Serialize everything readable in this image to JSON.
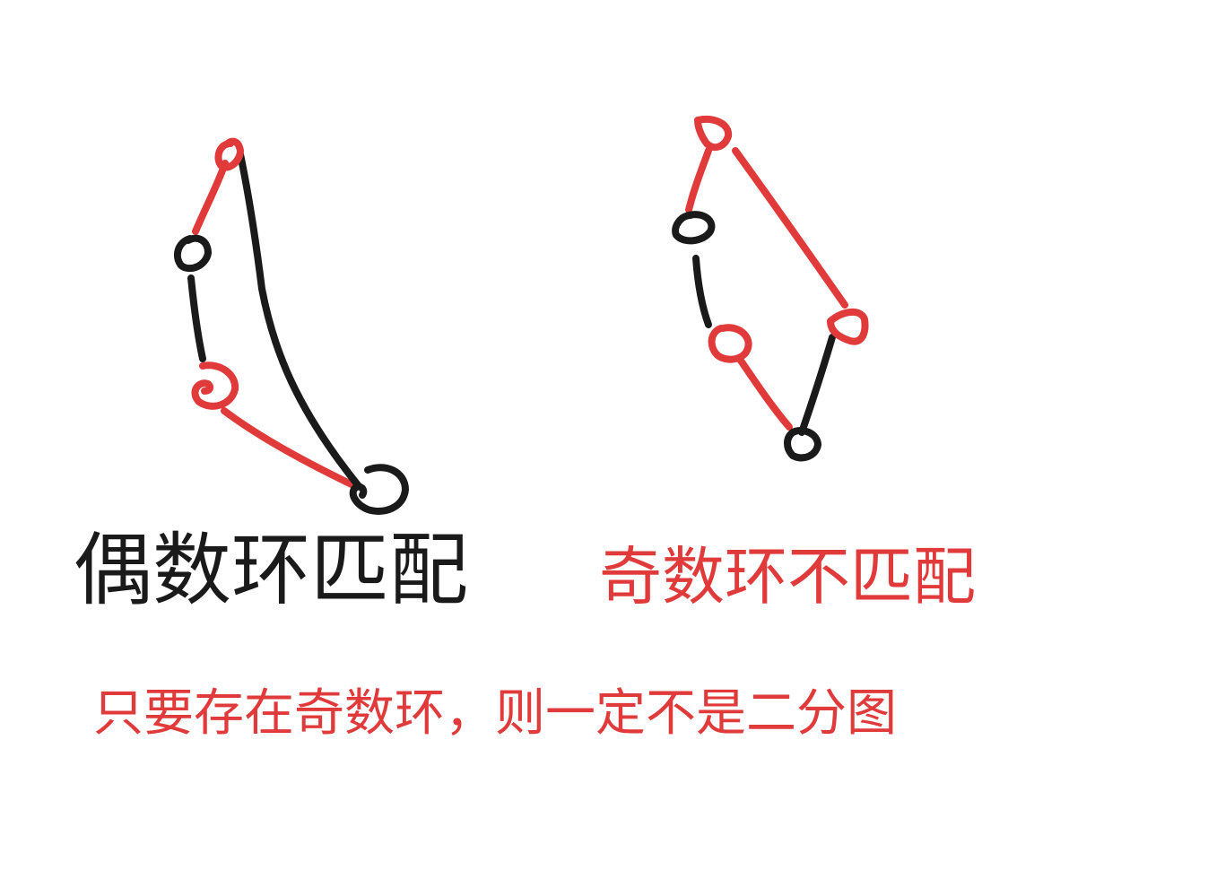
{
  "colors": {
    "red": "#e03a3a",
    "black": "#1a1a1a",
    "background": "#ffffff"
  },
  "even_cycle_label": "偶数环匹配",
  "odd_cycle_label": "奇数环不匹配",
  "conclusion": "只要存在奇数环，则一定不是二分图",
  "even_cycle": {
    "vertex_count": 4,
    "edge_colors": [
      "red",
      "black",
      "red",
      "black"
    ]
  },
  "odd_cycle": {
    "vertex_count": 5,
    "edge_colors": [
      "red",
      "black",
      "red",
      "black",
      "red"
    ]
  }
}
